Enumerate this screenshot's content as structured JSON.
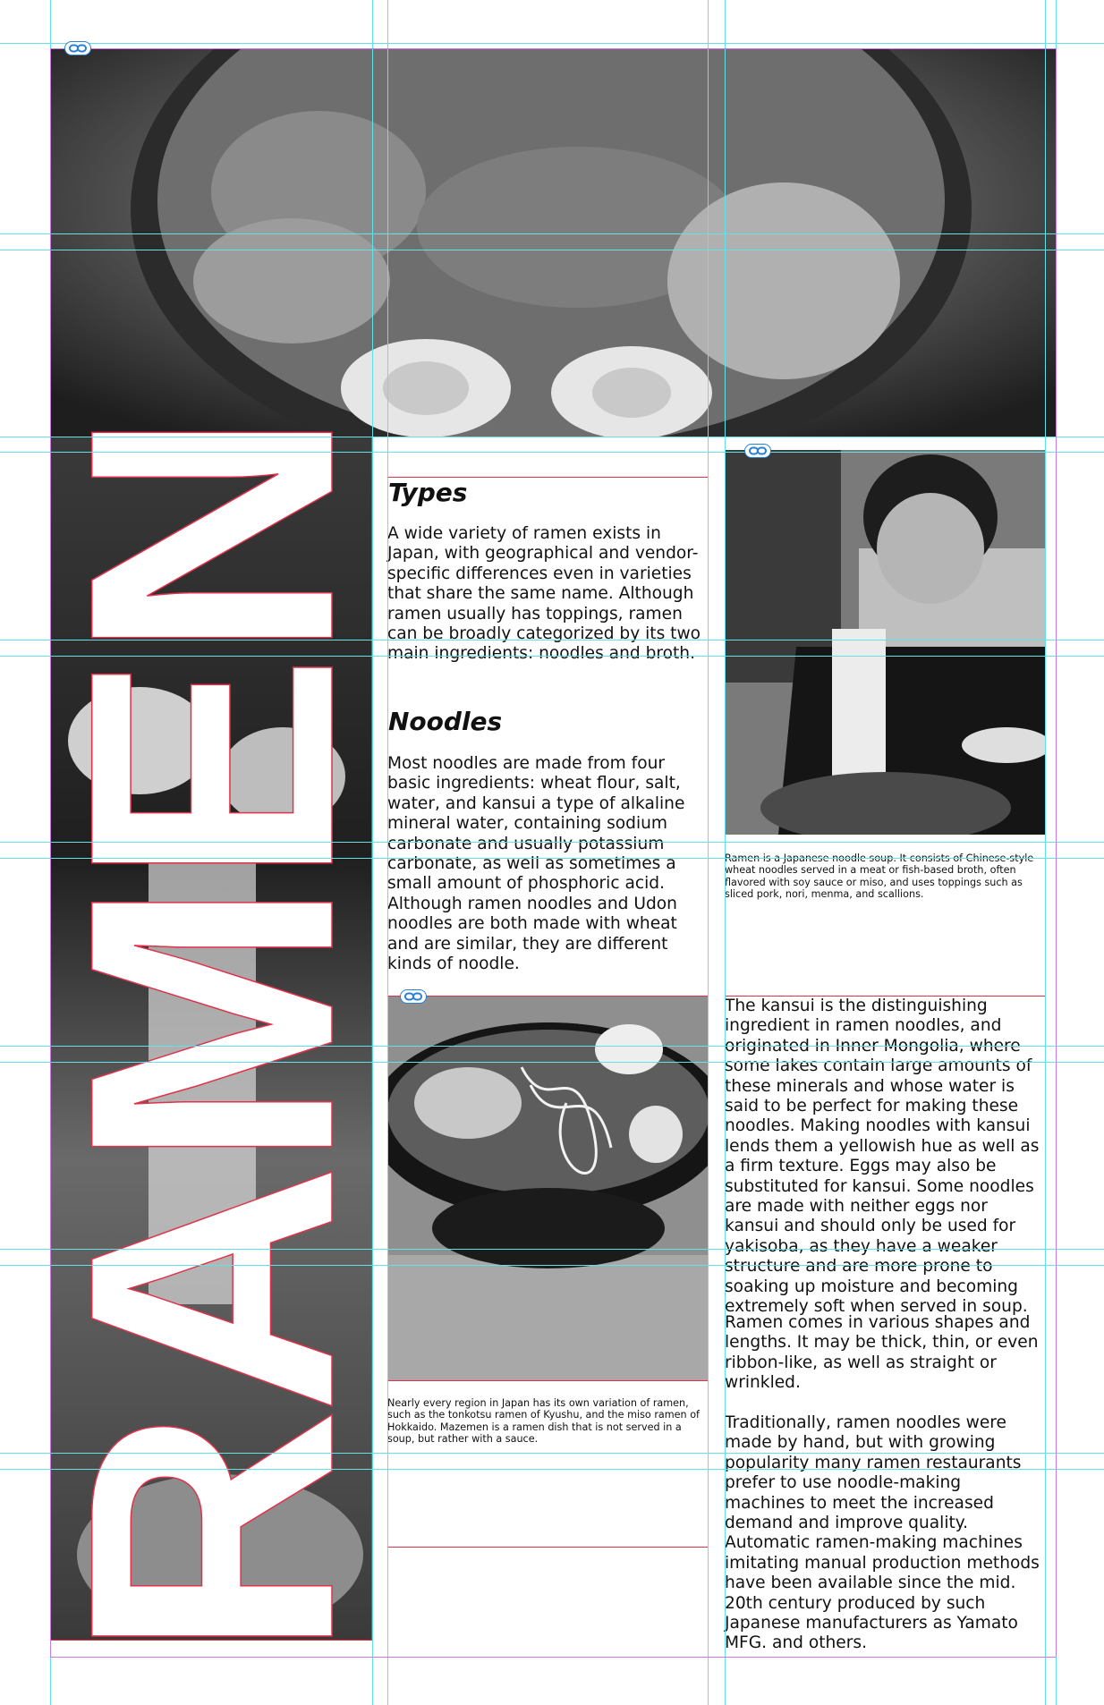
{
  "title_word": "RAMEN",
  "colors": {
    "guide": "#5fe3e6",
    "frame": "#e0334a",
    "margin": "#c77be0",
    "link": "#2a7fd4"
  },
  "icons": [
    "link-icon",
    "link-icon",
    "link-icon"
  ],
  "sections": {
    "types": {
      "heading": "Types",
      "body": "A wide variety of ramen exists in Japan, with geographical and vendor-specific differences even in varieties that share the same name. Although ramen usually has toppings, ramen can be broadly categorized by its two main ingredients: noodles and broth."
    },
    "noodles": {
      "heading": "Noodles",
      "body": "Most noodles are made from four basic ingredients: wheat flour, salt, water, and kansui a type of alkaline mineral water, containing sodium carbonate and usually potassium carbonate, as well as sometimes a small amount of phosphoric acid. Although ramen noodles and Udon noodles are both made with wheat and are similar, they are different kinds of noodle."
    }
  },
  "captions": {
    "boy": "Ramen is a Japanese noodle soup. It consists of Chinese-style wheat noodles served in a meat or fish-based broth, often flavored with soy sauce or miso, and uses toppings such as sliced pork, nori, menma, and scallions.",
    "bowl": "Nearly every region in Japan has its own variation of ramen, such as the tonkotsu ramen of Kyushu, and the miso ramen of Hokkaido. Mazemen is a ramen dish that is not served in a soup, but rather with a sauce."
  },
  "right_column": {
    "p1": "The kansui is the distinguishing ingredient in ramen noodles, and originated in Inner Mongolia, where some lakes contain large amounts of these minerals and whose water is said to be perfect for making these noodles. Making noodles with kansui lends them a yellowish hue as well as a firm texture. Eggs may also be substituted for kansui. Some noodles are made with neither eggs nor kansui and should only be used for yakisoba, as they have a weaker structure and are more prone to soaking up moisture and becoming extremely soft when served in soup.",
    "p2": "Ramen comes in various shapes and lengths. It may be thick, thin, or even ribbon-like, as well as straight or wrinkled.",
    "p3": "Traditionally, ramen noodles were made by hand, but with growing popularity many ramen restaurants prefer to use noodle-making machines to meet the increased demand and improve quality. Automatic ramen-making machines imitating manual production methods have been available since the mid. 20th century produced by such Japanese manufacturers as Yamato MFG. and others."
  }
}
